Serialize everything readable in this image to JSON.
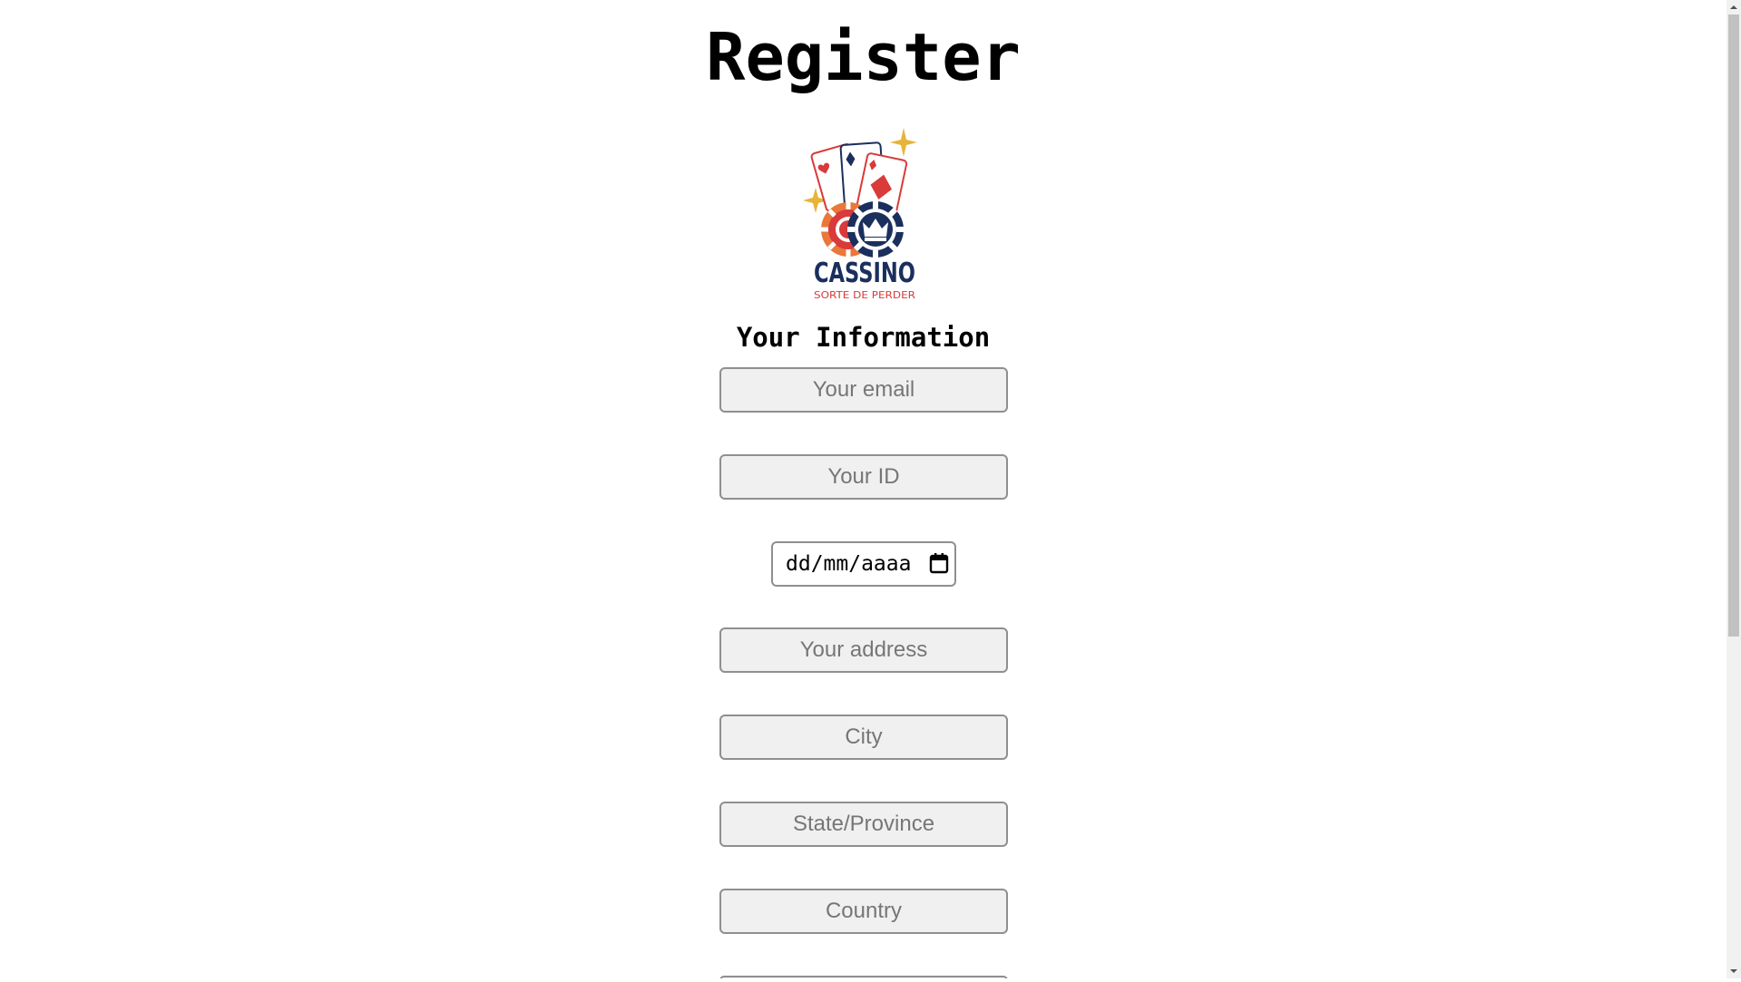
{
  "page": {
    "title": "Register",
    "section_title": "Your Information"
  },
  "logo": {
    "brand": "CASSINO",
    "tagline": "SORTE DE PERDER",
    "colors": {
      "navy": "#1b2f5e",
      "red": "#d93a3a",
      "gold": "#e8b339",
      "orange": "#e9783a"
    }
  },
  "form": {
    "email": {
      "placeholder": "Your email",
      "value": ""
    },
    "id": {
      "placeholder": "Your ID",
      "value": ""
    },
    "birthdate": {
      "placeholder": "dd/mm/aaaa",
      "value": ""
    },
    "address": {
      "placeholder": "Your address",
      "value": ""
    },
    "city": {
      "placeholder": "City",
      "value": ""
    },
    "state": {
      "placeholder": "State/Province",
      "value": ""
    },
    "country": {
      "placeholder": "Country",
      "value": ""
    }
  },
  "icons": {
    "calendar": "calendar-icon",
    "scroll_up": "chevron-up-icon",
    "scroll_down": "chevron-down-icon"
  }
}
